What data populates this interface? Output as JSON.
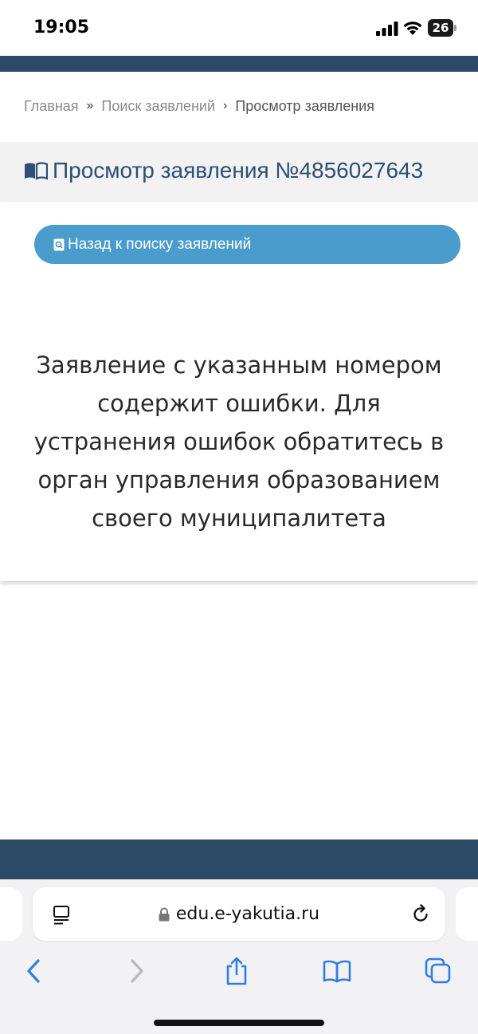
{
  "status_bar": {
    "time": "19:05",
    "battery_level": "26"
  },
  "breadcrumb": {
    "items": [
      "Главная",
      "Поиск заявлений",
      "Просмотр заявления"
    ],
    "separators": [
      "»",
      "›"
    ]
  },
  "view": {
    "title": "Просмотр заявления №4856027643",
    "back_button_label": "Назад к поиску заявлений",
    "message": "Заявление с указанным номером содержит ошибки. Для устранения ошибок обратитесь в орган управления образованием своего муниципалитета"
  },
  "browser": {
    "url": "edu.e-yakutia.ru"
  },
  "colors": {
    "brand_dark": "#2c4a66",
    "title_blue": "#2c4f73",
    "button_blue": "#4a9ccc",
    "ios_blue": "#2f7fe0"
  },
  "icons": [
    "signal-icon",
    "wifi-icon",
    "battery-icon",
    "book-icon",
    "search-doc-icon",
    "reader-icon",
    "lock-icon",
    "reload-icon",
    "back-icon",
    "forward-icon",
    "share-icon",
    "bookmarks-icon",
    "tabs-icon"
  ]
}
